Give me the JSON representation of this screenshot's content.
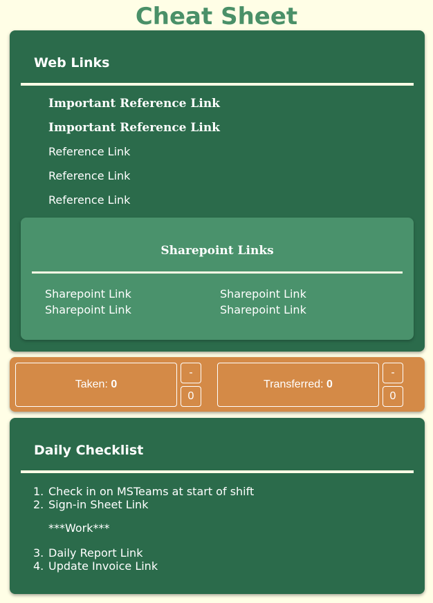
{
  "page": {
    "title": "Cheat Sheet"
  },
  "web_links": {
    "heading": "Web Links",
    "links": [
      "Important Reference Link",
      "Important Reference Link",
      "Reference Link",
      "Reference Link",
      "Reference Link"
    ],
    "sharepoint": {
      "heading": "Sharepoint Links",
      "links": [
        "Sharepoint Link",
        "Sharepoint Link",
        "Sharepoint Link",
        "Sharepoint Link"
      ]
    }
  },
  "counters": {
    "taken": {
      "label": "Taken:",
      "value": "0",
      "minus": "-",
      "count": "0"
    },
    "transferred": {
      "label": "Transferred:",
      "value": "0",
      "minus": "-",
      "count": "0"
    }
  },
  "daily": {
    "heading": "Daily Checklist",
    "items": [
      {
        "num": "1.",
        "text": "Check in on MSTeams at start of shift"
      },
      {
        "num": "2.",
        "text": "Sign-in Sheet Link"
      },
      {
        "num": "3.",
        "text": "Daily Report Link"
      },
      {
        "num": "4.",
        "text": "Update Invoice Link"
      }
    ],
    "work_note": "***Work***"
  }
}
